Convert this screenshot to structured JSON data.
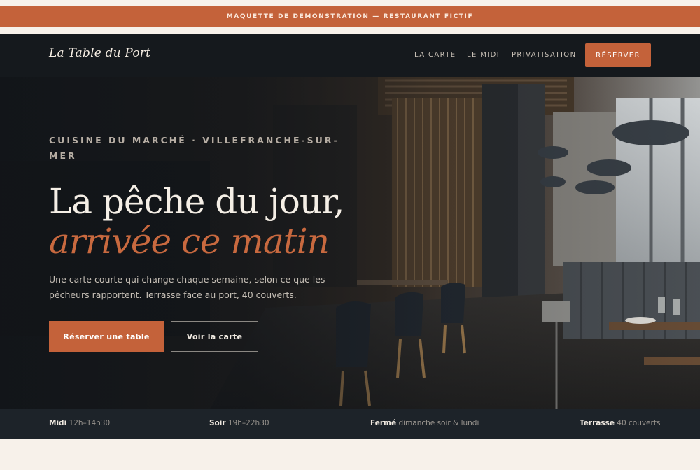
{
  "promo_banner": "MAQUETTE DE DÉMONSTRATION — RESTAURANT FICTIF",
  "header": {
    "logo": "La Table du Port",
    "nav": [
      "LA CARTE",
      "LE MIDI",
      "PRIVATISATION"
    ],
    "cta": "RÉSERVER"
  },
  "hero": {
    "kicker": "CUISINE DU MARCHÉ · VILLEFRANCHE-SUR-MER",
    "headline": "La pêche du jour,",
    "headline_accent": "arrivée ce matin",
    "lede": "Une carte courte qui change chaque semaine, selon ce que les pêcheurs rapportent. Terrasse face au port, 40 couverts.",
    "primary_button": "Réserver une table",
    "secondary_button": "Voir la carte",
    "background_image": "restaurant-dining-room-photo"
  },
  "info_bar": [
    {
      "label": "Midi",
      "value": "12h–14h30"
    },
    {
      "label": "Soir",
      "value": "19h–22h30"
    },
    {
      "label": "Fermé",
      "value": "dimanche soir & lundi"
    },
    {
      "label": "Terrasse",
      "value": "40 couverts"
    }
  ],
  "colors": {
    "accent": "#c4623a",
    "dark": "#15191d",
    "cream": "#f7f1ea"
  }
}
